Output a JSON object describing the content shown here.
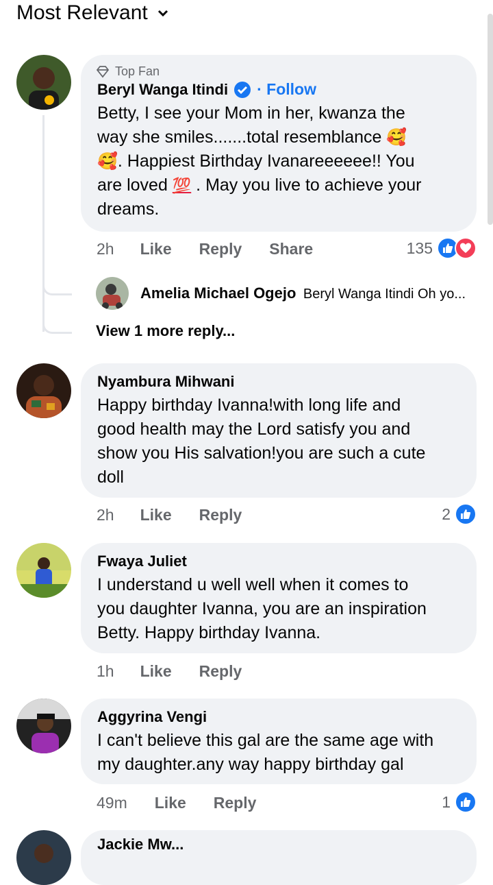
{
  "sort": {
    "label": "Most Relevant"
  },
  "comments": [
    {
      "badge": "Top Fan",
      "name": "Beryl Wanga Itindi",
      "follow": "· Follow",
      "text_lines": [
        "Betty, I see your Mom in her, kwanza the",
        "way she smiles.......total resemblance",
        ". Happiest Birthday Ivanareeeeee!! You",
        "are loved",
        ". May you live to achieve your",
        "dreams."
      ],
      "time": "2h",
      "like": "Like",
      "reply": "Reply",
      "share": "Share",
      "reactions": "135",
      "reply_preview": {
        "name": "Amelia Michael Ogejo",
        "snippet": "Beryl Wanga Itindi Oh yo..."
      },
      "view_more": "View 1 more reply..."
    },
    {
      "name": "Nyambura Mihwani",
      "text_lines": [
        "Happy birthday Ivanna!with long life and",
        "good health may the Lord satisfy you and",
        "show you His salvation!you are such a cute",
        "doll"
      ],
      "time": "2h",
      "like": "Like",
      "reply": "Reply",
      "reactions": "2"
    },
    {
      "name": "Fwaya Juliet",
      "text_lines": [
        "I understand u well well when it comes to",
        "you daughter Ivanna, you are an inspiration",
        "Betty. Happy birthday Ivanna."
      ],
      "time": "1h",
      "like": "Like",
      "reply": "Reply"
    },
    {
      "name": "Aggyrina Vengi",
      "text_lines": [
        "I can't believe this gal are the same age with",
        "my daughter.any way happy birthday gal"
      ],
      "time": "49m",
      "like": "Like",
      "reply": "Reply",
      "reactions": "1"
    },
    {
      "name": "Jackie Mw..."
    }
  ],
  "emoji": {
    "love_face": "🥰",
    "hundred": "💯"
  },
  "colors": {
    "accent": "#1877f2",
    "love": "#f33e58",
    "bubble": "#f0f2f5"
  },
  "icons": [
    "chevron-down-icon",
    "diamond-icon",
    "verified-badge-icon",
    "like-reaction-icon",
    "love-reaction-icon"
  ]
}
